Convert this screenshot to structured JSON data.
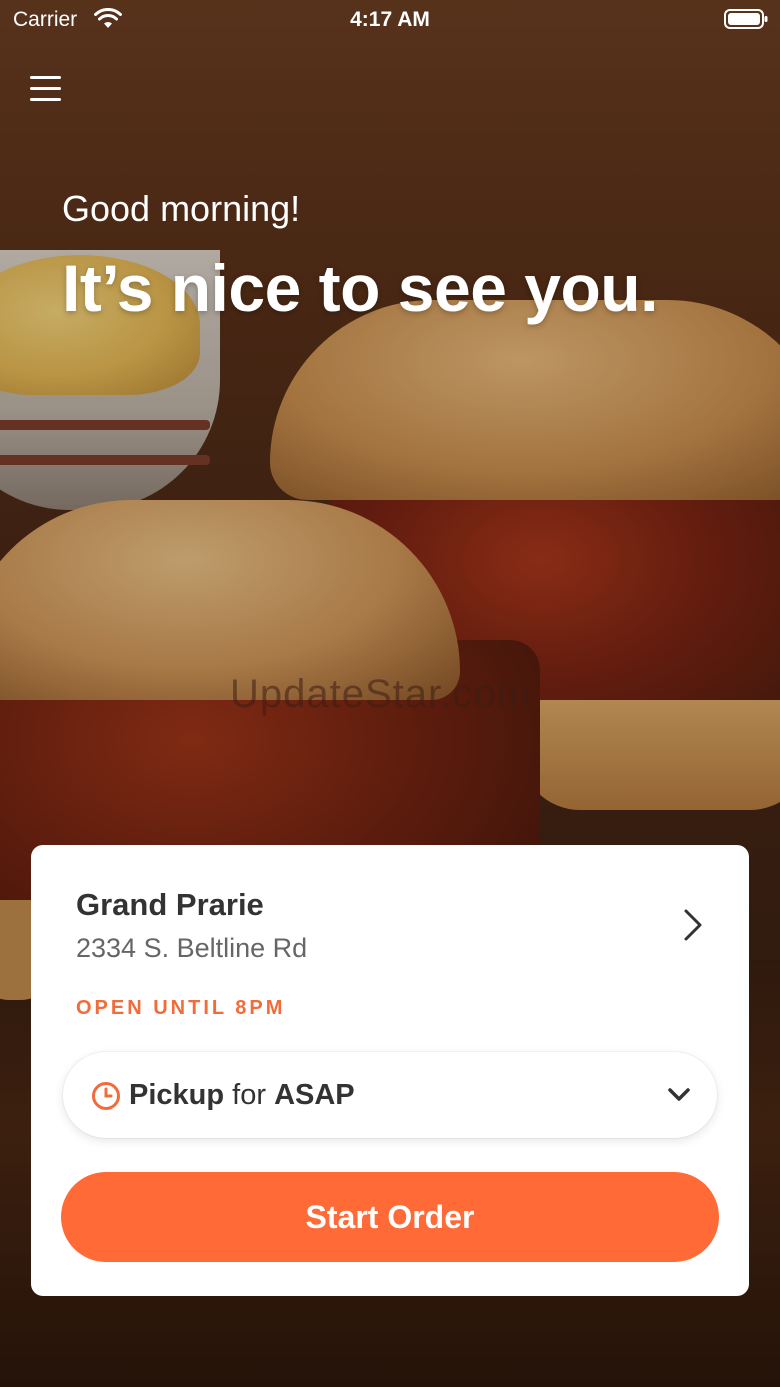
{
  "status_bar": {
    "carrier": "Carrier",
    "time": "4:17 AM"
  },
  "header": {
    "menu_icon": "hamburger-menu-icon"
  },
  "hero": {
    "greeting": "Good morning!",
    "headline": "It’s nice to see you.",
    "watermark": "UpdateStar.com"
  },
  "location_card": {
    "store_name": "Grand Prarie",
    "store_address": "2334 S. Beltline Rd",
    "open_status": "OPEN UNTIL 8PM",
    "order_type": {
      "mode": "Pickup",
      "connector": "for",
      "time": "ASAP"
    },
    "start_button_label": "Start Order"
  },
  "colors": {
    "accent": "#ff6a36",
    "status_text": "#f26b3a",
    "card_background": "#ffffff"
  }
}
